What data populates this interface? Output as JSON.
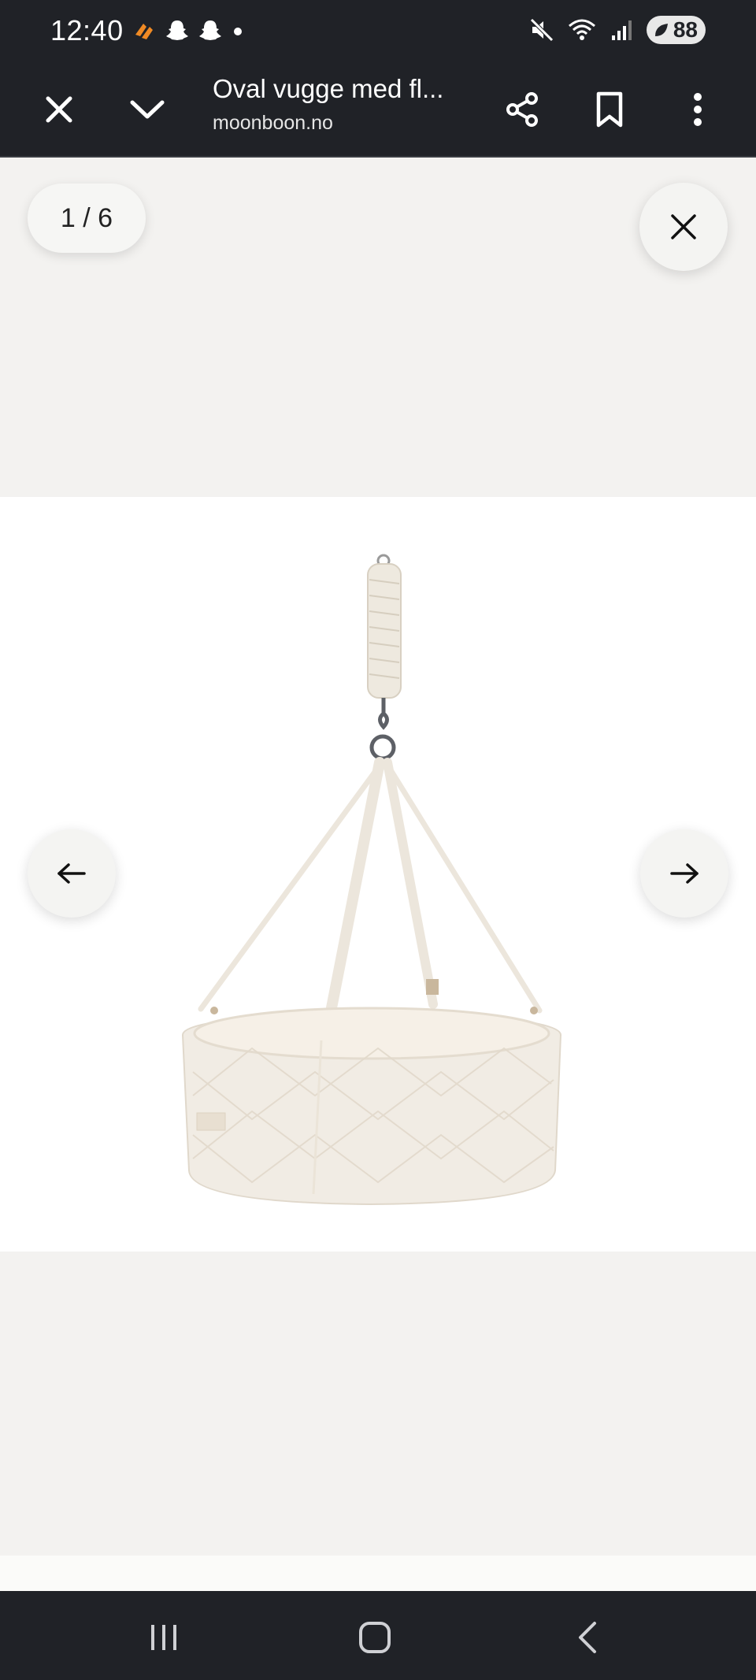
{
  "status_bar": {
    "time": "12:40",
    "battery_level": "88",
    "icons": [
      "app-notification-icon",
      "snapchat-icon",
      "snapchat-icon",
      "dot-icon",
      "mute-icon",
      "wifi-icon",
      "signal-icon",
      "battery-icon"
    ]
  },
  "toolbar": {
    "title": "Oval vugge med fl...",
    "domain": "moonboon.no",
    "icons": [
      "close-icon",
      "chevron-down-icon",
      "share-icon",
      "bookmark-icon",
      "more-vert-icon"
    ]
  },
  "gallery": {
    "counter": "1 / 6",
    "current_index": 1,
    "total": 6,
    "image_subject": "hanging oval cradle",
    "icons": [
      "close-icon",
      "arrow-left-icon",
      "arrow-right-icon"
    ]
  },
  "nav_bar": {
    "icons": [
      "recent-apps-icon",
      "home-icon",
      "back-icon"
    ]
  },
  "colors": {
    "chrome": "#202227",
    "page_background": "#f3f2f0",
    "image_background": "#ffffff",
    "accent_orange": "#f08a24"
  }
}
